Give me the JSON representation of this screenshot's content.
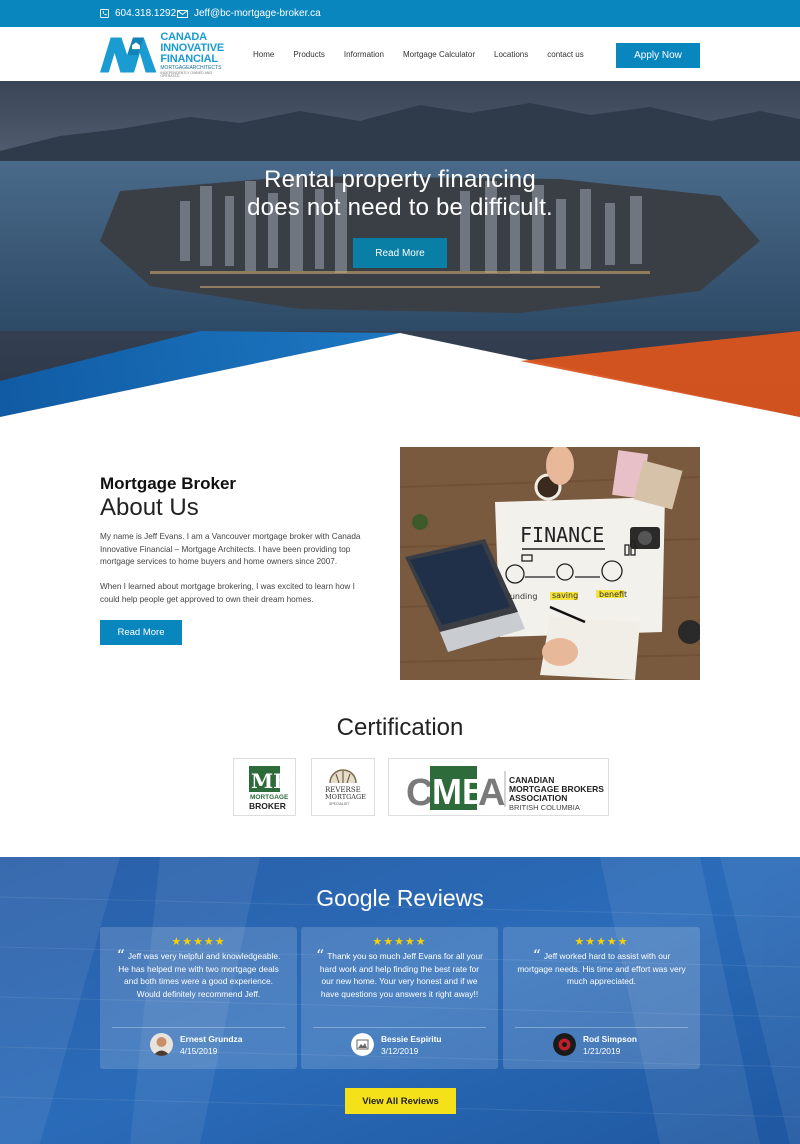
{
  "topbar": {
    "phone": "604.318.1292",
    "email": "Jeff@bc-mortgage-broker.ca",
    "phone_icon": "phone-icon",
    "email_icon": "envelope-icon"
  },
  "header": {
    "logo": {
      "line1": "CANADA",
      "line2": "INNOVATIVE",
      "line3": "FINANCIAL",
      "line4": "MORTGAGEARCHITECTS",
      "line5": "INDEPENDENTLY OWNED AND OPERATED"
    },
    "nav": [
      "Home",
      "Products",
      "Information",
      "Mortgage Calculator",
      "Locations",
      "contact us"
    ],
    "apply_label": "Apply Now"
  },
  "hero": {
    "line1": "Rental property financing",
    "line2": "does not need to be difficult.",
    "button": "Read More"
  },
  "about": {
    "subtitle": "Mortgage Broker",
    "title": "About Us",
    "p1": "My name is Jeff Evans. I am a Vancouver mortgage broker with Canada Innovative Financial – Mortgage Architects. I have been providing top mortgage services to home buyers and home owners since 2007.",
    "p2": "When I learned about mortgage brokering, I was excited to learn how I could help people get approved to own their dream homes.",
    "button": "Read More",
    "image": {
      "heading": "FINANCE",
      "labels": [
        "funding",
        "saving",
        "benefit"
      ]
    }
  },
  "certification": {
    "title": "Certification",
    "mb": {
      "mark": "MB",
      "word": "MORTGAGE",
      "word2": "BROKER"
    },
    "reverse": {
      "word1": "REVERSE",
      "word2": "MORTGAGE",
      "word3": "SPECIALIST"
    },
    "cmba": {
      "letters": [
        "C",
        "MB",
        "A"
      ],
      "line1": "CANADIAN",
      "line2": "MORTGAGE BROKERS",
      "line3": "ASSOCIATION",
      "line4": "BRITISH COLUMBIA"
    }
  },
  "reviews": {
    "title": "Google Reviews",
    "stars": "★★★★★",
    "items": [
      {
        "quote": "Jeff was very helpful and knowledgeable. He has helped me with two mortgage deals and both times were a good experience. Would definitely recommend Jeff.",
        "name": "Ernest Grundza",
        "date": "4/15/2019"
      },
      {
        "quote": "Thank you so much Jeff Evans for all your hard work and help finding the best rate for our new home. Your very honest and if we have questions you answers it right away!!",
        "name": "Bessie Espiritu",
        "date": "3/12/2019"
      },
      {
        "quote": "Jeff worked hard to assist with our mortgage needs. His time and effort was very much appreciated.",
        "name": "Rod Simpson",
        "date": "1/21/2019"
      }
    ],
    "button": "View All Reviews"
  },
  "colors": {
    "primary": "#0a86bf",
    "accent_orange": "#d9541e",
    "review_button": "#f5e11a",
    "stars": "#f5d10a"
  }
}
